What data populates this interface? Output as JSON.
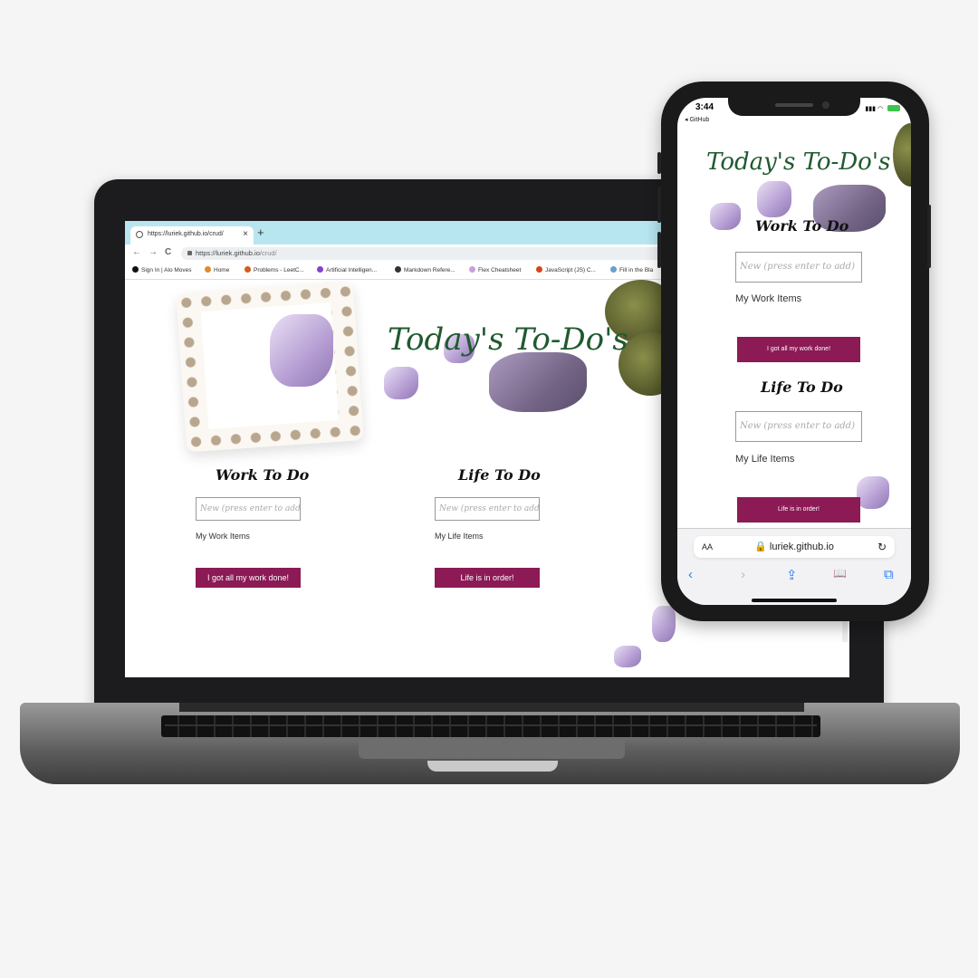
{
  "laptop": {
    "tab_title": "https://luriek.github.io/crud/",
    "tab_close": "×",
    "new_tab": "+",
    "nav": {
      "back": "←",
      "forward": "→",
      "reload": "C"
    },
    "url_host": "https://luriek.github.io",
    "url_path": "/crud/",
    "bookmarks": [
      "Sign In | Alo Moves",
      "Home",
      "Problems - LeetC...",
      "Artificial Intelligen...",
      "Markdown Refere...",
      "Flex Cheatsheet",
      "JavaScript (JS) C...",
      "Fill in the Bla"
    ],
    "bookmark_colors": [
      "#111111",
      "#e08a2e",
      "#d25b1e",
      "#8a3fd1",
      "#333333",
      "#c9a0dc",
      "#d9421c",
      "#6aa0c9"
    ]
  },
  "app": {
    "title": "Today's To-Do's",
    "work": {
      "heading": "Work To Do",
      "placeholder": "New (press enter to add)",
      "items_label": "My Work Items",
      "button": "I got all my work done!"
    },
    "life": {
      "heading": "Life To Do",
      "placeholder": "New (press enter to add)",
      "items_label": "My Life Items",
      "button": "Life is in order!"
    },
    "colors": {
      "title": "#1f5a2f",
      "button": "#8b1a55"
    }
  },
  "phone": {
    "time": "3:44",
    "back_label": "◂ GitHub",
    "safari": {
      "aa": "AA",
      "domain": "🔒 luriek.github.io",
      "reload": "↻"
    },
    "tools": [
      "‹",
      "›",
      "⇪",
      "📖",
      "⧉"
    ]
  }
}
